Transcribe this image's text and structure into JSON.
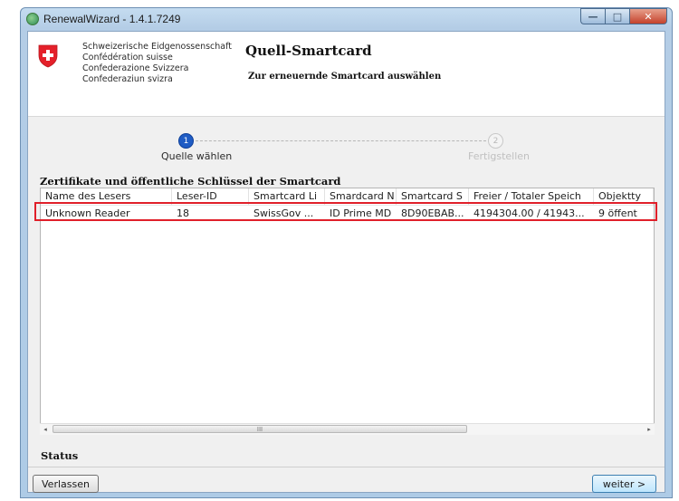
{
  "window": {
    "title": "RenewalWizard - 1.4.1.7249",
    "minimize_glyph": "—",
    "maximize_glyph": "□",
    "close_glyph": "✕"
  },
  "header": {
    "confederation_lines": [
      "Schweizerische Eidgenossenschaft",
      "Confédération suisse",
      "Confederazione Svizzera",
      "Confederaziun svizra"
    ],
    "title": "Quell-Smartcard",
    "subtitle": "Zur erneuernde Smartcard auswählen"
  },
  "steps": [
    {
      "number": "1",
      "label": "Quelle wählen",
      "active": true
    },
    {
      "number": "2",
      "label": "Fertigstellen",
      "active": false
    }
  ],
  "section_title": "Zertifikate und öffentliche Schlüssel der Smartcard",
  "table": {
    "columns": [
      "Name des Lesers",
      "Leser-ID",
      "Smartcard Li",
      "Smardcard N",
      "Smartcard S",
      "Freier / Totaler Speich",
      "Objektty"
    ],
    "rows": [
      [
        "Unknown Reader",
        "18",
        "SwissGov ...",
        "ID Prime MD",
        "8D90EBAB...",
        "4194304.00 / 41943...",
        "9 öffent"
      ]
    ]
  },
  "scrollbar": {
    "left_arrow": "◂",
    "right_arrow": "▸",
    "grip": "III"
  },
  "status_label": "Status",
  "buttons": {
    "quit": "Verlassen",
    "next": "weiter >"
  },
  "colors": {
    "highlight": "#e0202a",
    "step_active": "#1f5cc4",
    "swiss_red": "#e4202a"
  }
}
